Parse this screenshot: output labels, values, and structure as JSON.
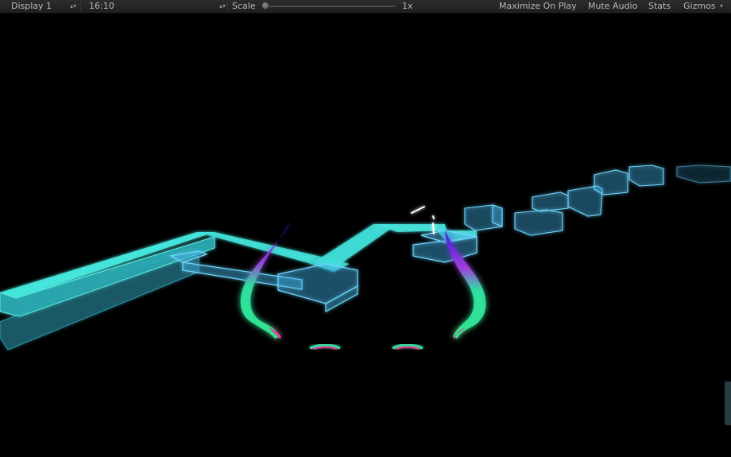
{
  "toolbar": {
    "display": "Display 1",
    "aspect": "16:10",
    "scale_label": "Scale",
    "scale_value": "1x",
    "scale_fraction": 0.0,
    "maximize_on_play": "Maximize On Play",
    "mute_audio": "Mute Audio",
    "stats": "Stats",
    "gizmos": "Gizmos"
  },
  "scene": {
    "background": "#000000",
    "track_color": "#3de0d8",
    "block_color": "#5fd0ff",
    "wing_colors": [
      "#2ee6a0",
      "#7040e0",
      "#e040a0"
    ]
  }
}
